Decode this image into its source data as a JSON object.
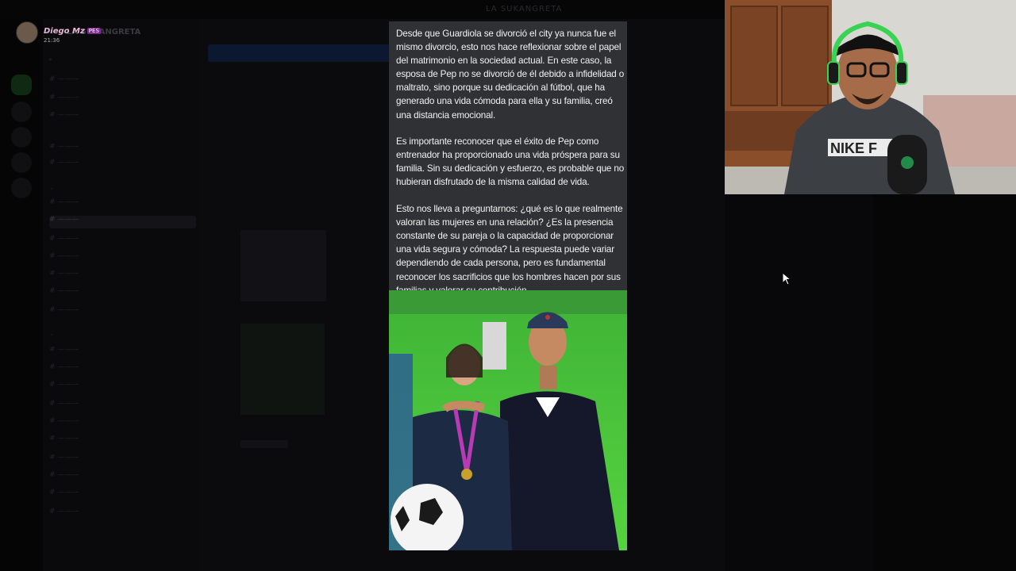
{
  "window": {
    "title": "LA SUKANGRETA"
  },
  "server": {
    "name": "LA SUKANGRETA"
  },
  "streamer": {
    "name": "Diego Mz",
    "badge": "PES",
    "time": "21:36"
  },
  "post": {
    "paragraphs": [
      "Desde que Guardiola se divorció el city ya nunca fue el mismo divorcio, esto nos hace reflexionar sobre el papel del matrimonio en la sociedad actual. En este caso, la esposa de Pep no se divorció de él debido a infidelidad o maltrato, sino porque su dedicación al fútbol, que ha generado una vida cómoda para ella y su familia, creó una distancia emocional.",
      "Es importante reconocer que el éxito de Pep como entrenador ha proporcionado una vida próspera para su familia. Sin su dedicación y esfuerzo, es probable que no hubieran disfrutado de la misma calidad de vida.",
      "Esto nos lleva a preguntarnos: ¿qué es lo que realmente valoran las mujeres en una relación? ¿Es la presencia constante de su pareja o la capacidad de proporcionar una vida segura y cómoda? La respuesta puede variar dependiendo de cada persona, pero es fundamental reconocer los sacrificios que los hombres hacen por sus familias y valorar su contribución."
    ]
  },
  "webcam": {
    "shirt_text": "NIKE F"
  },
  "colors": {
    "post_bg": "#2f3134",
    "grass": "#4fc63a",
    "jacket": "#1c2a44"
  }
}
